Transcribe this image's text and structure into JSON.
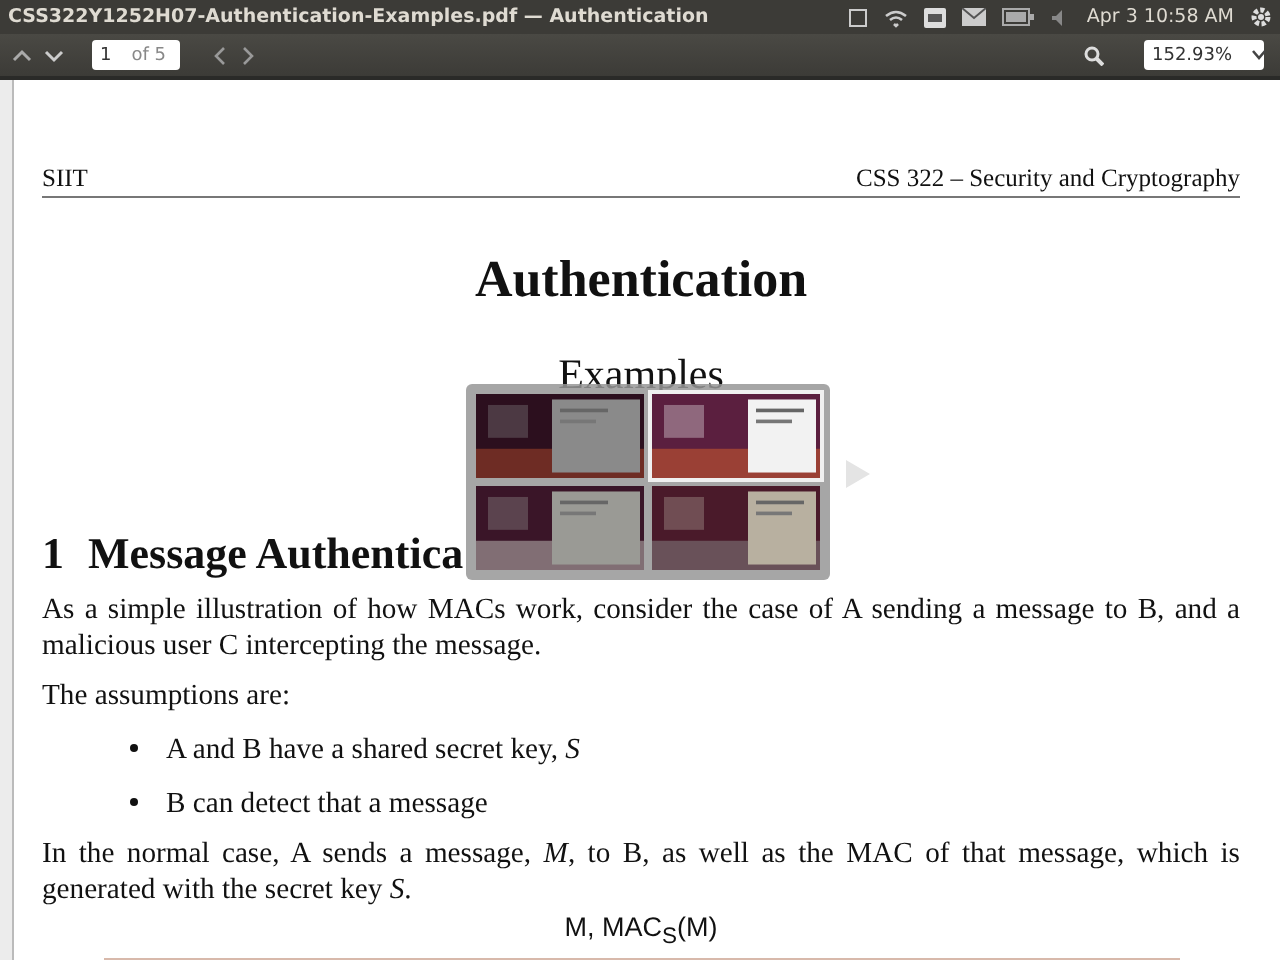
{
  "window": {
    "title": "CSS322Y1252H07-Authentication-Examples.pdf — Authentication"
  },
  "panel": {
    "clock": "Apr 3 10:58 AM"
  },
  "toolbar": {
    "page_number": "1",
    "page_count": "of 5",
    "zoom": "152.93%"
  },
  "document": {
    "header_left": "SIIT",
    "header_right": "CSS 322 – Security and Cryptography",
    "title": "Authentication",
    "subtitle": "Examples",
    "section_number": "1",
    "section_title": "Message Authentica",
    "blocks": [
      {
        "kind": "paragraph",
        "text": "As a simple illustration of how MACs work, consider the case of A sending a message to B, and a malicious user C intercepting the message."
      },
      {
        "kind": "paragraph",
        "text": "The assumptions are:"
      },
      {
        "kind": "bullet",
        "text": "A and B have a shared secret key, *S*"
      },
      {
        "kind": "bullet",
        "text": "B can detect that a message"
      },
      {
        "kind": "paragraph",
        "text": "In the normal case, A sends a message, *M*, to B, as well as the MAC of that message, which is generated with the secret key *S*."
      },
      {
        "kind": "diagram",
        "text": "M, MAC$_{S}$(M)"
      }
    ]
  },
  "workspace_switcher": {
    "workspaces": [
      {
        "selected": false
      },
      {
        "selected": true
      },
      {
        "selected": false
      },
      {
        "selected": false
      }
    ]
  }
}
